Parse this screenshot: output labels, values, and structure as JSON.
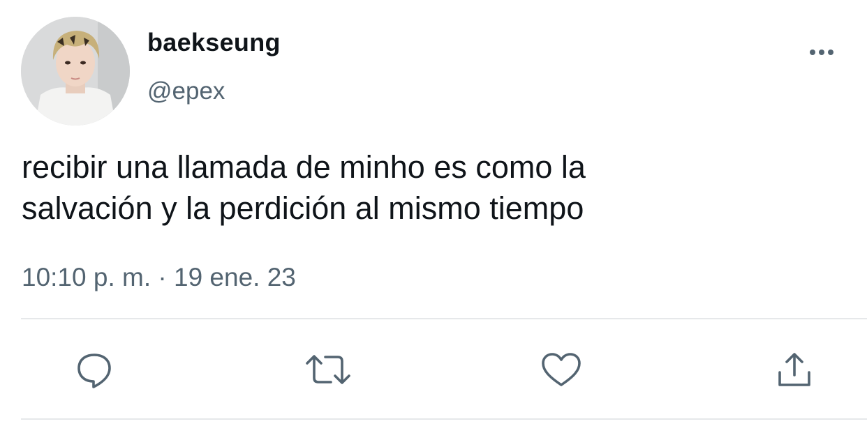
{
  "tweet": {
    "author": {
      "display_name": "baekseung",
      "handle": "@epex"
    },
    "text_lines": [
      "recibir una llamada de minho es como la",
      "salvación y la perdición al mismo tiempo"
    ],
    "timestamp": "10:10 p. m. · 19 ene. 23"
  },
  "actions": [
    {
      "icon": "reply-icon"
    },
    {
      "icon": "retweet-icon"
    },
    {
      "icon": "like-icon"
    },
    {
      "icon": "share-icon"
    }
  ],
  "colors": {
    "text_primary": "#0f1419",
    "text_secondary": "#536471",
    "icon": "#536471",
    "divider": "#e6e8ea",
    "background": "#ffffff"
  }
}
